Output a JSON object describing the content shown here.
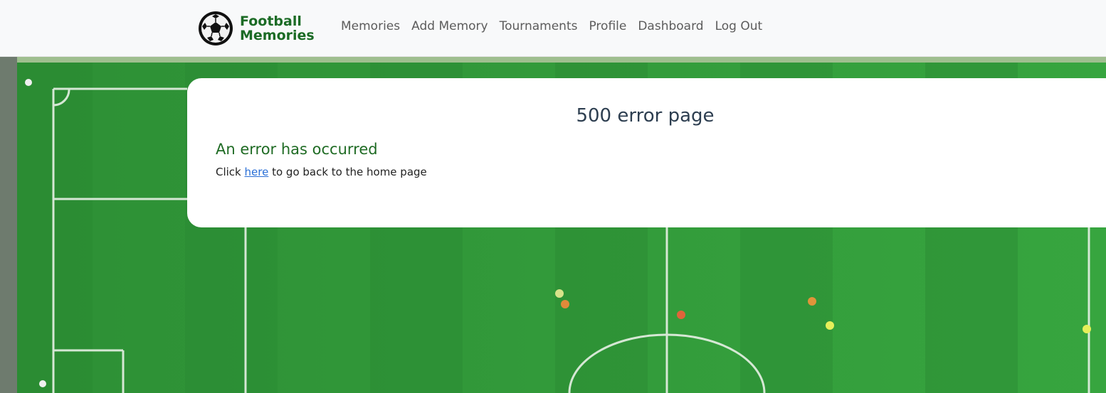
{
  "navbar": {
    "brand": {
      "line1": "Football",
      "line2": "Memories",
      "logo_icon": "soccer-ball-icon",
      "color": "#1b6b25"
    },
    "links": [
      {
        "label": "Memories"
      },
      {
        "label": "Add Memory"
      },
      {
        "label": "Tournaments"
      },
      {
        "label": "Profile"
      },
      {
        "label": "Dashboard"
      },
      {
        "label": "Log Out"
      }
    ]
  },
  "card": {
    "title": "500 error page",
    "heading": "An error has occurred",
    "text_before": "Click ",
    "link_label": "here",
    "text_after": " to go back to the home page"
  },
  "colors": {
    "heading_green": "#1f6b24",
    "title": "#2d3e50",
    "link": "#2a6fd6",
    "pitch": "#2f9a3a"
  }
}
